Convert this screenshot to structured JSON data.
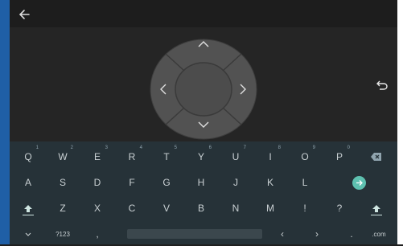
{
  "colors": {
    "accent": "#5ec1b0",
    "keyboard_bg": "#263238",
    "stage_bg": "#252525",
    "dpad_ring": "#555555",
    "dpad_center": "#505050"
  },
  "topbar": {
    "back_icon": "arrow-left-icon"
  },
  "dpad": {
    "up_icon": "chevron-up-icon",
    "down_icon": "chevron-down-icon",
    "left_icon": "chevron-left-icon",
    "right_icon": "chevron-right-icon"
  },
  "undo_icon": "undo-icon",
  "keyboard": {
    "row1": [
      {
        "label": "Q",
        "hint": "1"
      },
      {
        "label": "W",
        "hint": "2"
      },
      {
        "label": "E",
        "hint": "3"
      },
      {
        "label": "R",
        "hint": "4"
      },
      {
        "label": "T",
        "hint": "5"
      },
      {
        "label": "Y",
        "hint": "6"
      },
      {
        "label": "U",
        "hint": "7"
      },
      {
        "label": "I",
        "hint": "8"
      },
      {
        "label": "O",
        "hint": "9"
      },
      {
        "label": "P",
        "hint": "0"
      }
    ],
    "backspace_icon": "backspace-icon",
    "row2": [
      "A",
      "S",
      "D",
      "F",
      "G",
      "H",
      "J",
      "K",
      "L"
    ],
    "enter_icon": "enter-icon",
    "row3": [
      "Z",
      "X",
      "C",
      "V",
      "B",
      "N",
      "M",
      "!",
      "?"
    ],
    "shift_icon": "shift-icon",
    "row4": {
      "collapse_icon": "chevron-down-icon",
      "symbols": "?123",
      "comma": ",",
      "left_arrow": "‹",
      "right_arrow": "›",
      "period": ".",
      "dotcom": ".com"
    }
  }
}
